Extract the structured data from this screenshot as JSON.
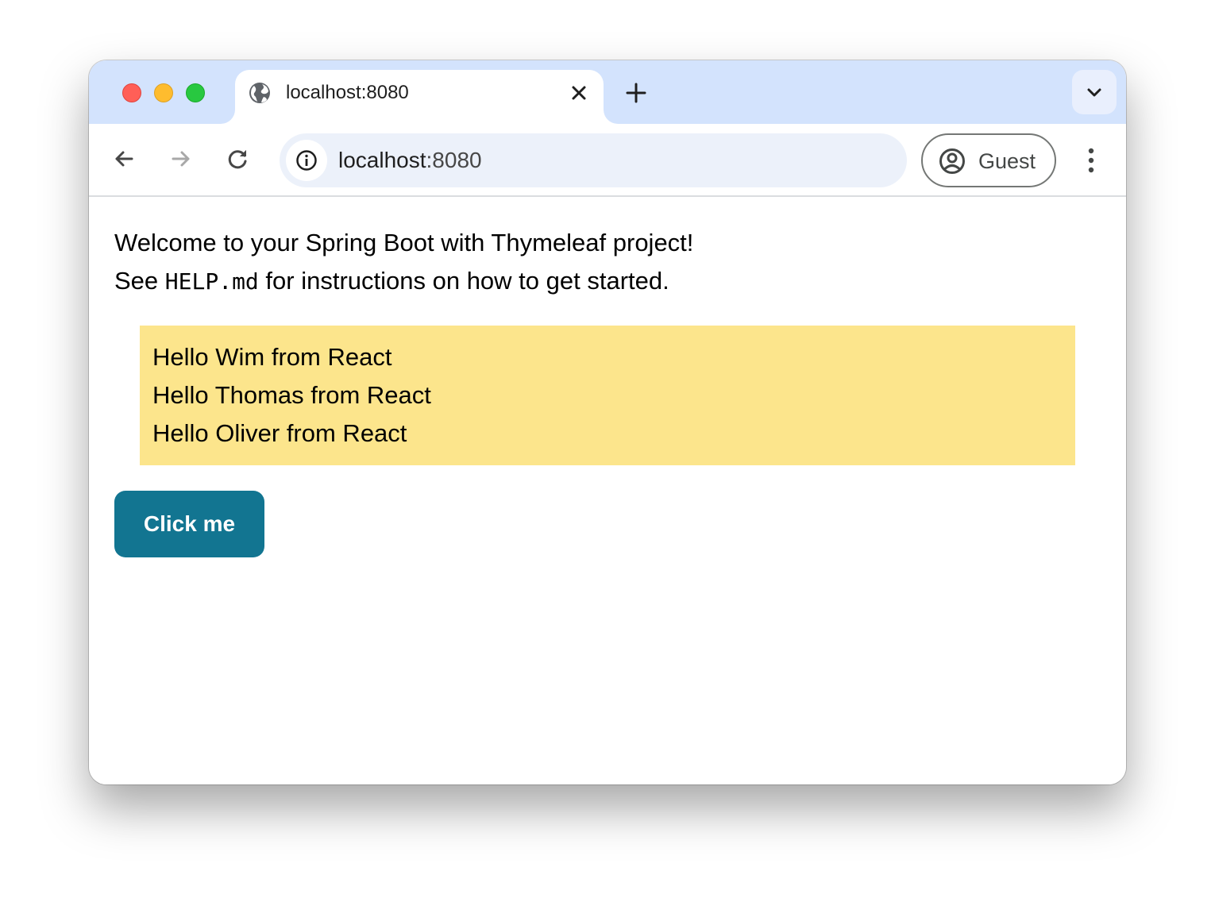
{
  "browser": {
    "tab": {
      "title": "localhost:8080",
      "icon": "globe-icon",
      "close_icon": "close-icon"
    },
    "new_tab_icon": "plus-icon",
    "tab_search_icon": "chevron-down-icon",
    "nav": {
      "back_icon": "arrow-left-icon",
      "forward_icon": "arrow-right-icon",
      "reload_icon": "reload-icon"
    },
    "omnibox": {
      "site_info_icon": "info-icon",
      "host": "localhost",
      "port": ":8080"
    },
    "profile": {
      "label": "Guest",
      "icon": "account-circle-icon"
    },
    "menu_icon": "kebab-menu-icon"
  },
  "page": {
    "intro_line1": "Welcome to your Spring Boot with Thymeleaf project!",
    "intro_line2_prefix": "See ",
    "intro_line2_code": "HELP.md",
    "intro_line2_suffix": " for instructions on how to get started.",
    "greetings": [
      "Hello Wim from React",
      "Hello Thomas from React",
      "Hello Oliver from React"
    ],
    "button_label": "Click me"
  },
  "colors": {
    "tabstrip": "#d3e3fd",
    "omnibox": "#ecf1fa",
    "greeting_box": "#fce58c",
    "button": "#127591"
  }
}
